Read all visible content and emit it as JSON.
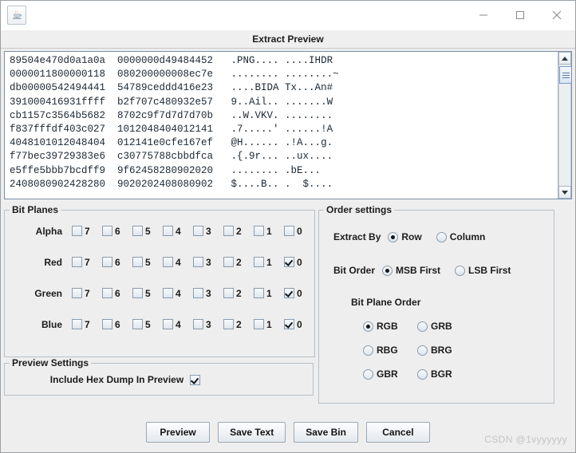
{
  "window": {
    "app_icon": "java-coffee-cup-icon",
    "minimize_label": "—",
    "maximize_label": "□",
    "close_label": "✕"
  },
  "dialog": {
    "title": "Extract Preview"
  },
  "hex_preview": {
    "lines": [
      "89504e470d0a1a0a  0000000d49484452   .PNG.... ....IHDR",
      "0000011800000118  080200000008ec7e   ........ ........~",
      "db00000542494441  54789ceddd416e23   ....BIDA Tx...An#",
      "391000416931ffff  b2f707c480932e57   9..Ail.. .......W",
      "cb1157c3564b5682  8702c9f7d7d7d70b   ..W.VKV. ........",
      "f837fffdf403c027  1012048404012141   .7.....' ......!A",
      "4048101012048404  012141e0cfe167ef   @H...... .!A...g.",
      "f77bec39729383e6  c30775788cbbdfca   .{.9r... ..ux....",
      "e5ffe5bbb7bcdff9  9f62458280902020   ........ .bE...",
      "2408080902428280  9020202408080902   $....B.. .  $...."
    ],
    "scrollbar": {
      "up_arrow": "scroll-up-arrow-icon",
      "down_arrow": "scroll-down-arrow-icon"
    }
  },
  "bit_planes": {
    "legend": "Bit Planes",
    "bit_labels": [
      "7",
      "6",
      "5",
      "4",
      "3",
      "2",
      "1",
      "0"
    ],
    "rows": [
      {
        "label": "Alpha",
        "checked": [
          false,
          false,
          false,
          false,
          false,
          false,
          false,
          false
        ]
      },
      {
        "label": "Red",
        "checked": [
          false,
          false,
          false,
          false,
          false,
          false,
          false,
          true
        ]
      },
      {
        "label": "Green",
        "checked": [
          false,
          false,
          false,
          false,
          false,
          false,
          false,
          true
        ]
      },
      {
        "label": "Blue",
        "checked": [
          false,
          false,
          false,
          false,
          false,
          false,
          false,
          true
        ]
      }
    ]
  },
  "order_settings": {
    "legend": "Order settings",
    "extract_by": {
      "label": "Extract By",
      "options": [
        {
          "label": "Row",
          "selected": true
        },
        {
          "label": "Column",
          "selected": false
        }
      ]
    },
    "bit_order": {
      "label": "Bit Order",
      "options": [
        {
          "label": "MSB First",
          "selected": true
        },
        {
          "label": "LSB First",
          "selected": false
        }
      ]
    },
    "bit_plane_order": {
      "label": "Bit Plane Order",
      "options": [
        {
          "label": "RGB",
          "selected": true
        },
        {
          "label": "GRB",
          "selected": false
        },
        {
          "label": "RBG",
          "selected": false
        },
        {
          "label": "BRG",
          "selected": false
        },
        {
          "label": "GBR",
          "selected": false
        },
        {
          "label": "BGR",
          "selected": false
        }
      ]
    }
  },
  "preview_settings": {
    "legend": "Preview Settings",
    "include_hex_dump": {
      "label": "Include Hex Dump In Preview",
      "checked": true
    }
  },
  "buttons": [
    {
      "label": "Preview"
    },
    {
      "label": "Save Text"
    },
    {
      "label": "Save Bin"
    },
    {
      "label": "Cancel"
    }
  ],
  "watermark": "CSDN @1vyyyyyy"
}
